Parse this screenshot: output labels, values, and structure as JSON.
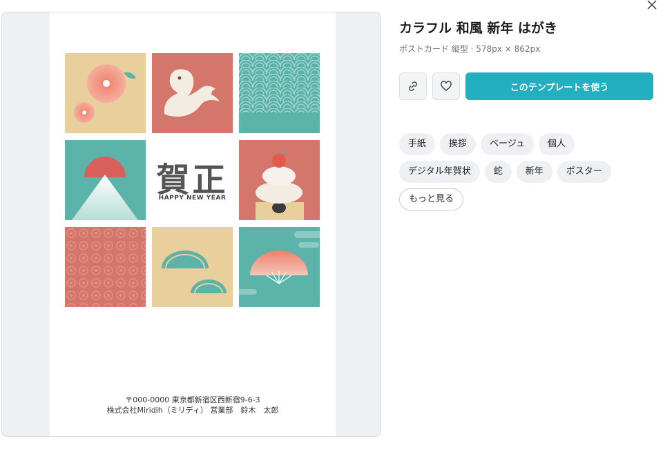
{
  "preview": {
    "card": {
      "kanji": "賀正",
      "greeting": "HAPPY NEW YEAR",
      "address_line": "〒000-0000 東京都新宿区西新宿9-6-3",
      "sender_line": "株式会社Miridih（ミリディ） 営業部　鈴木　太郎"
    }
  },
  "details": {
    "title": "カラフル 和風 新年 はがき",
    "subtitle": "ポストカード 縦型 · 578px × 862px",
    "use_button_label": "このテンプレートを使う",
    "tags": [
      "手紙",
      "挨拶",
      "ベージュ",
      "個人",
      "デジタル年賀状",
      "蛇",
      "新年",
      "ポスター"
    ],
    "more_label": "もっと見る"
  },
  "icons": {
    "close": "close-icon",
    "link": "link-icon",
    "favorite": "heart-icon"
  },
  "colors": {
    "accent": "#22b0c1",
    "beige": "#e9cf9c",
    "coral": "#d4766c",
    "teal": "#5cb3aa"
  }
}
